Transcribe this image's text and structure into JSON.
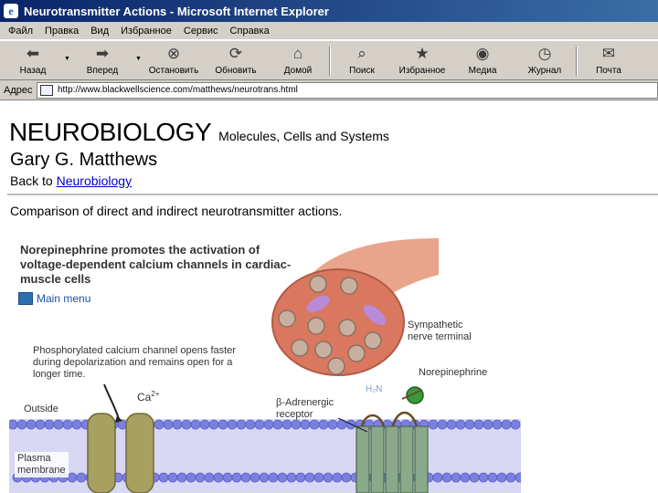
{
  "window": {
    "title": "Neurotransmitter Actions - Microsoft Internet Explorer",
    "app_icon_glyph": "e"
  },
  "menubar": {
    "items": [
      "Файл",
      "Правка",
      "Вид",
      "Избранное",
      "Сервис",
      "Справка"
    ]
  },
  "toolbar": {
    "buttons": [
      {
        "label": "Назад",
        "icon": "back-arrow-icon"
      },
      {
        "label": "Вперед",
        "icon": "forward-arrow-icon"
      },
      {
        "label": "Остановить",
        "icon": "stop-icon"
      },
      {
        "label": "Обновить",
        "icon": "refresh-icon"
      },
      {
        "label": "Домой",
        "icon": "home-icon"
      },
      {
        "label": "Поиск",
        "icon": "search-icon"
      },
      {
        "label": "Избранное",
        "icon": "favorites-icon"
      },
      {
        "label": "Медиа",
        "icon": "media-icon"
      },
      {
        "label": "Журнал",
        "icon": "history-icon"
      },
      {
        "label": "Почта",
        "icon": "mail-icon"
      }
    ]
  },
  "address": {
    "label": "Адрес",
    "url": "http://www.blackwellscience.com/matthews/neurotrans.html"
  },
  "page": {
    "book_title": "NEUROBIOLOGY",
    "book_subtitle": "Molecules, Cells and Systems",
    "author": "Gary G. Matthews",
    "back_prefix": "Back to",
    "back_link": "Neurobiology",
    "description": "Comparison of direct and indirect neurotransmitter actions."
  },
  "figure": {
    "heading": "Norepinephrine promotes the activation of voltage-dependent calcium channels in cardiac-muscle cells",
    "main_menu": "Main menu",
    "caption": "Phosphorylated calcium channel opens faster during depolarization and remains open for a longer time.",
    "ca_label": "Ca",
    "ca_charge": "2+",
    "outside_label": "Outside",
    "plasma_label_1": "Plasma",
    "plasma_label_2": "membrane",
    "receptor_label_1": "β-Adrenergic",
    "receptor_label_2": "receptor",
    "terminal_label_1": "Sympathetic",
    "terminal_label_2": "nerve terminal",
    "ne_label": "Norepinephrine",
    "h2n_label": "H₂N",
    "colors": {
      "membrane_head": "#7b80e0",
      "terminal": "#d9785f",
      "vesicle": "#c8b0a0",
      "channel": "#a8a060",
      "receptor": "#8aa88a"
    }
  }
}
